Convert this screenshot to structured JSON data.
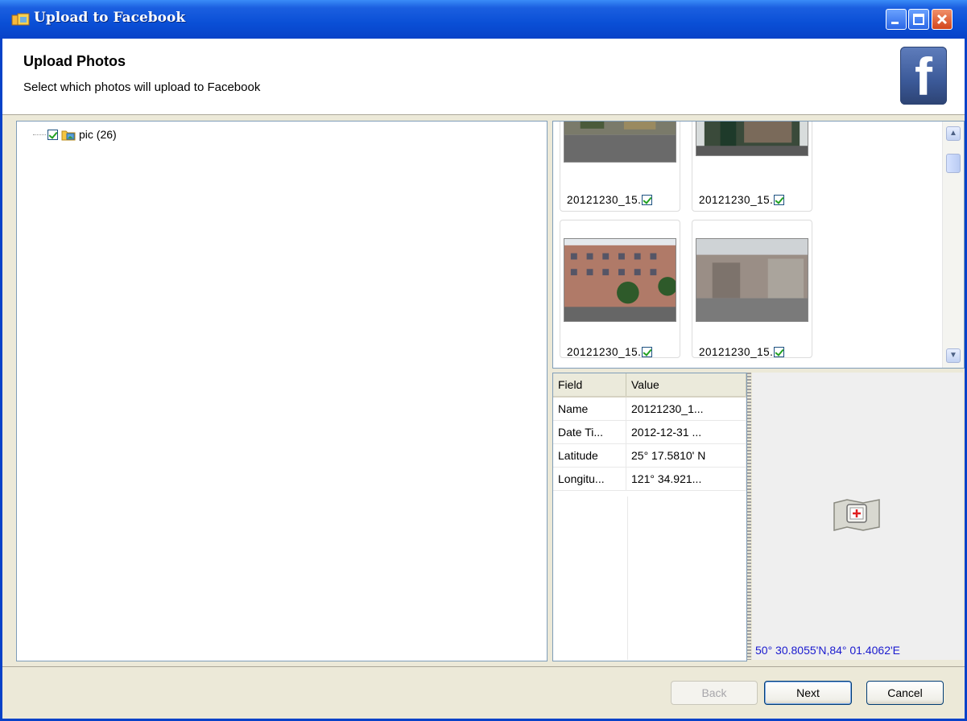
{
  "window": {
    "title": "Upload to Facebook"
  },
  "header": {
    "title": "Upload Photos",
    "subtitle": "Select which photos will upload to Facebook",
    "logo_letter": "f"
  },
  "tree": {
    "node_label": "pic (26)"
  },
  "gallery": {
    "items": [
      {
        "caption": "20121230_15."
      },
      {
        "caption": "20121230_15."
      },
      {
        "caption": "20121230_15."
      },
      {
        "caption": "20121230_15."
      }
    ]
  },
  "properties": {
    "headers": [
      "Field",
      "Value"
    ],
    "rows": [
      {
        "field": "Name",
        "value": "20121230_1..."
      },
      {
        "field": "Date Ti...",
        "value": "2012-12-31 ..."
      },
      {
        "field": "Latitude",
        "value": "25° 17.5810' N"
      },
      {
        "field": "Longitu...",
        "value": "121° 34.921..."
      }
    ]
  },
  "map": {
    "coordinates": "50° 30.8055'N,84° 01.4062'E"
  },
  "buttons": {
    "back": "Back",
    "next": "Next",
    "cancel": "Cancel"
  }
}
